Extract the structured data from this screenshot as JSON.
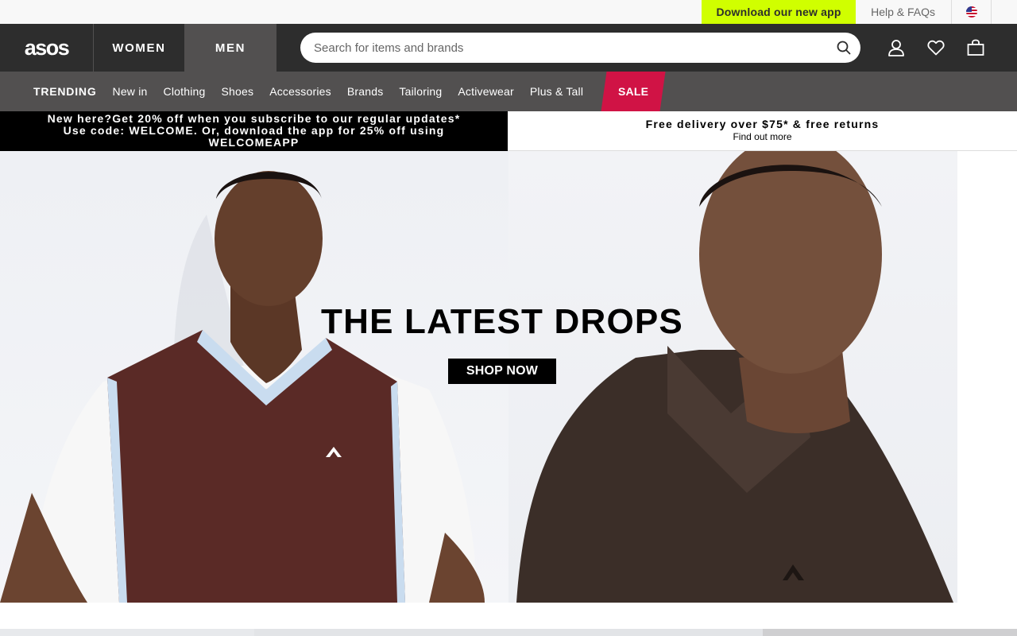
{
  "utility": {
    "app_link": "Download our new app",
    "help_link": "Help & FAQs"
  },
  "header": {
    "logo": "asos",
    "genders": [
      {
        "label": "WOMEN"
      },
      {
        "label": "MEN"
      }
    ],
    "search_placeholder": "Search for items and brands",
    "icons": [
      "account-icon",
      "heart-icon",
      "bag-icon"
    ]
  },
  "categories": [
    {
      "label": "TRENDING"
    },
    {
      "label": "New in"
    },
    {
      "label": "Clothing"
    },
    {
      "label": "Shoes"
    },
    {
      "label": "Accessories"
    },
    {
      "label": "Brands"
    },
    {
      "label": "Tailoring"
    },
    {
      "label": "Activewear"
    },
    {
      "label": "Plus & Tall"
    },
    {
      "label": "SALE"
    }
  ],
  "promo": {
    "left_line1": "New here?Get 20% off when you subscribe to our regular updates*",
    "left_line2": "Use code: WELCOME. Or, download the app for 25% off using",
    "left_line3": "WELCOMEAPP",
    "right_title": "Free delivery over $75* & free returns",
    "right_sub": "Find out more"
  },
  "hero": {
    "title": "THE LATEST DROPS",
    "cta": "SHOP NOW"
  },
  "colors": {
    "app_accent": "#d0ff00",
    "header_bg": "#2d2d2d",
    "catbar_bg": "#525050",
    "sale": "#d01345"
  }
}
